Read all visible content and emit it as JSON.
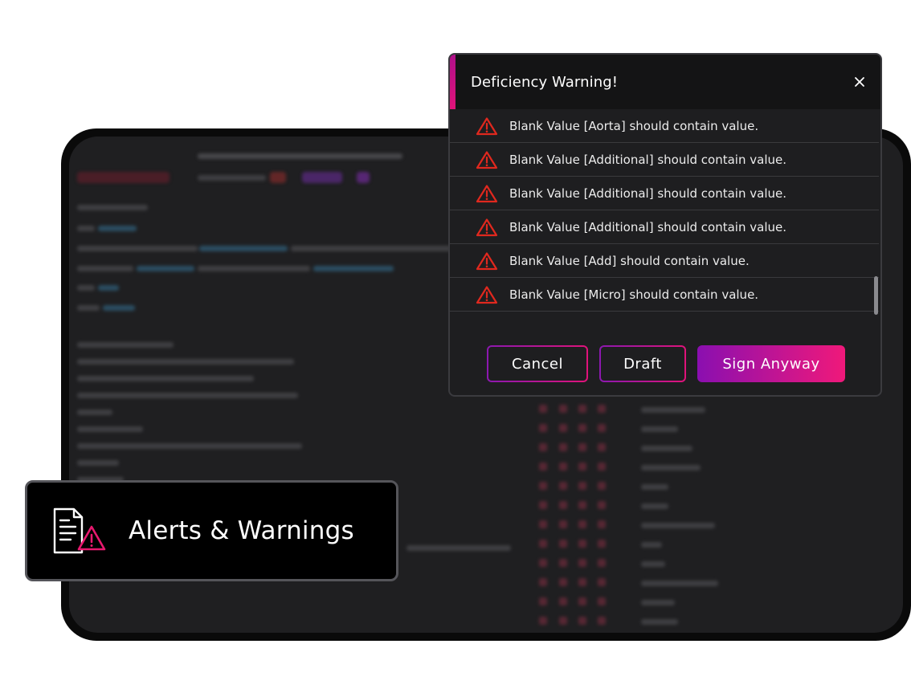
{
  "dialog": {
    "title": "Deficiency Warning!",
    "messages": [
      "Blank Value [Aorta] should contain value.",
      "Blank Value [Additional] should contain value.",
      "Blank Value [Additional] should contain value.",
      "Blank Value [Additional] should contain value.",
      "Blank Value [Add] should contain value.",
      "Blank Value [Micro] should contain value."
    ],
    "buttons": {
      "cancel": "Cancel",
      "draft": "Draft",
      "sign": "Sign Anyway"
    }
  },
  "badge": {
    "label": "Alerts & Warnings"
  },
  "icons": {
    "close": "close-icon",
    "warning": "warning-triangle-icon",
    "badge": "document-alert-icon"
  },
  "colors": {
    "accent_start": "#8a0fb0",
    "accent_end": "#f0197a",
    "warning_red": "#e0281e",
    "dialog_bg": "#1e1e20"
  }
}
